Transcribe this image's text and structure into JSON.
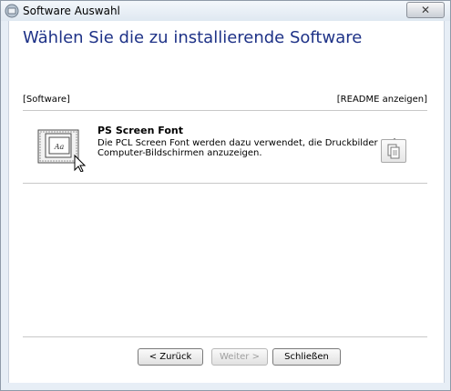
{
  "window": {
    "title": "Software Auswahl",
    "close_symbol": "✕"
  },
  "page": {
    "heading": "Wählen Sie die zu installierende Software"
  },
  "list": {
    "left_header": "[Software]",
    "right_header": "[README anzeigen]",
    "items": [
      {
        "title": "PS Screen Font",
        "description": "Die PCL Screen Font werden dazu verwendet, die Druckbilder auf Computer-Bildschirmen anzuzeigen.",
        "icon": "font-install-icon",
        "readme_icon": "document-icon"
      }
    ]
  },
  "footer": {
    "back": "< Zurück",
    "next": "Weiter >",
    "close": "Schließen"
  },
  "colors": {
    "heading": "#1e3287",
    "window_frame": "#e7eef6"
  }
}
